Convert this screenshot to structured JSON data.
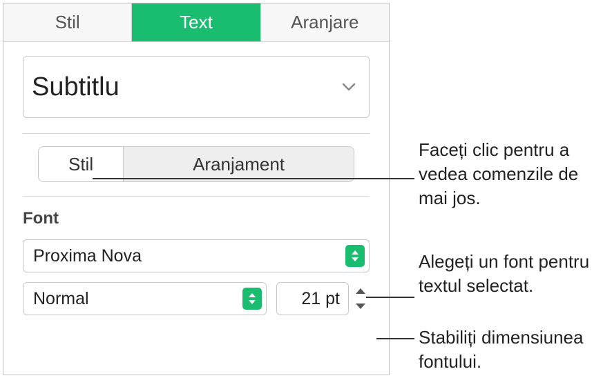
{
  "topTabs": {
    "stil": "Stil",
    "text": "Text",
    "aranjare": "Aranjare"
  },
  "paragraphStyle": "Subtitlu",
  "segTabs": {
    "stil": "Stil",
    "aranjament": "Aranjament"
  },
  "fontSection": {
    "label": "Font",
    "family": "Proxima Nova",
    "style": "Normal",
    "size": "21 pt"
  },
  "callouts": {
    "c1": "Faceți clic pentru a vedea comenzile de mai jos.",
    "c2": "Alegeți un font pentru textul selectat.",
    "c3": "Stabiliți dimensiunea fontului."
  }
}
